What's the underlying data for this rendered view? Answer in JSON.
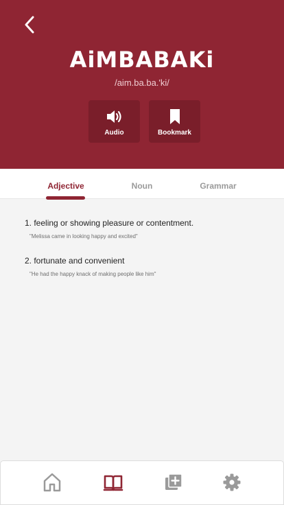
{
  "header": {
    "word": "AiMBABAKi",
    "phonetic": "/aim.ba.ba.'ki/",
    "actions": [
      {
        "label": "Audio",
        "icon": "speaker-icon"
      },
      {
        "label": "Bookmark",
        "icon": "bookmark-icon"
      }
    ],
    "back_icon": "chevron-left-icon"
  },
  "tabs": [
    {
      "label": "Adjective",
      "active": true
    },
    {
      "label": "Noun",
      "active": false
    },
    {
      "label": "Grammar",
      "active": false
    }
  ],
  "definitions": [
    {
      "text": "1. feeling or showing pleasure or contentment.",
      "example": "\"Melissa came in looking happy and excited\""
    },
    {
      "text": "2. fortunate and convenient",
      "example": "\"He had the happy knack of making people like him\""
    }
  ],
  "bottom_nav": [
    {
      "icon": "home-icon",
      "active": false
    },
    {
      "icon": "book-icon",
      "active": true
    },
    {
      "icon": "add-library-icon",
      "active": false
    },
    {
      "icon": "gear-icon",
      "active": false
    }
  ],
  "colors": {
    "accent": "#8f2533",
    "accent_dark": "#7a1e2a",
    "inactive": "#9a9a9a",
    "background": "#f4f4f4"
  }
}
